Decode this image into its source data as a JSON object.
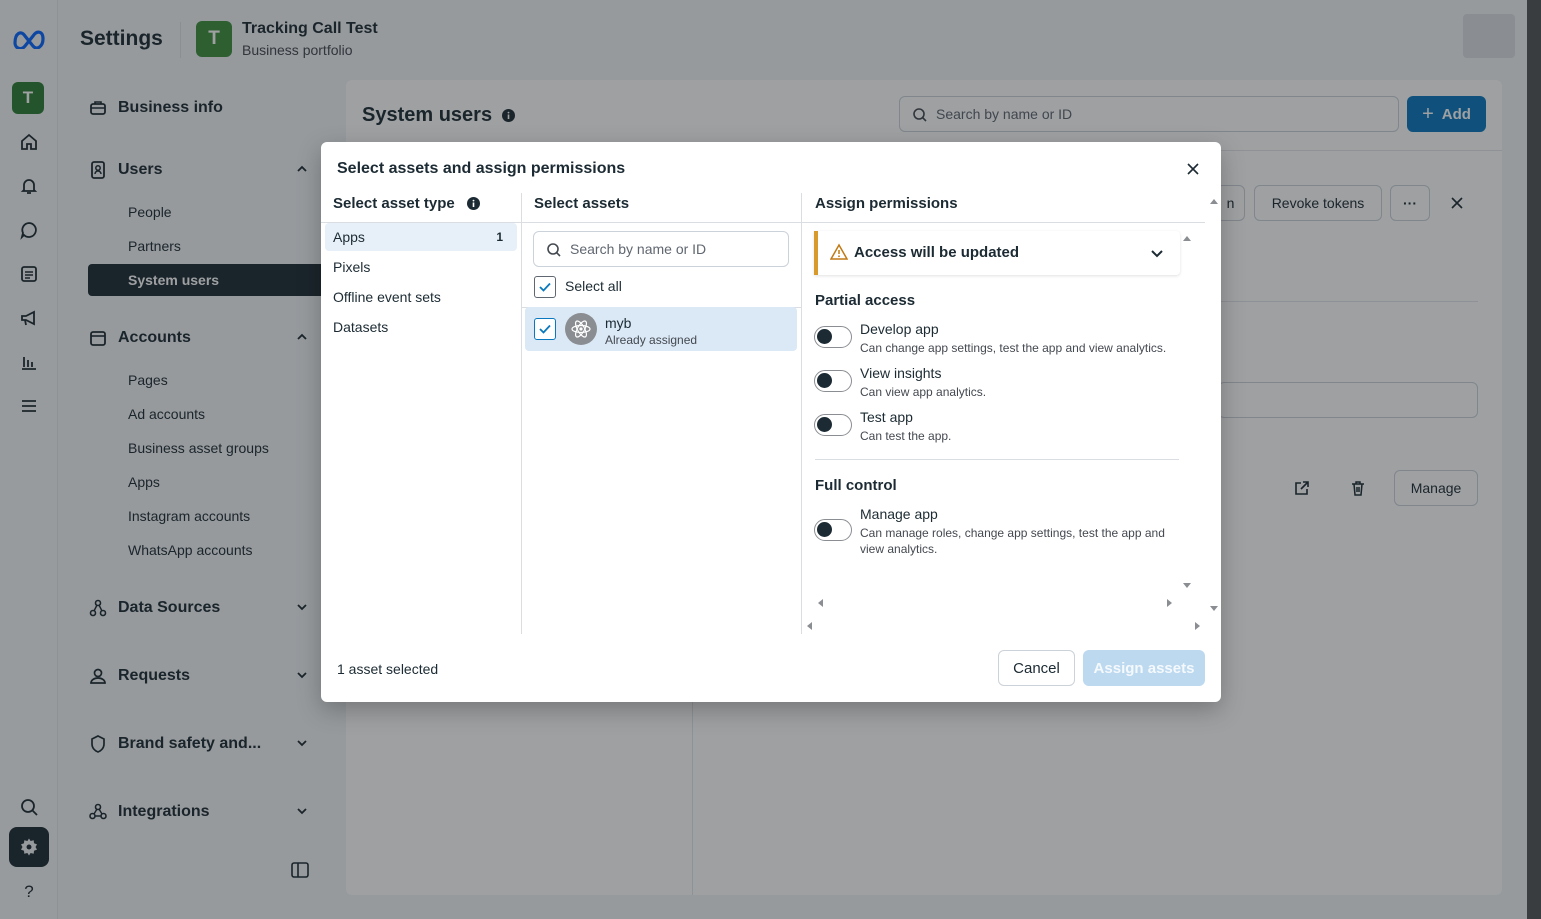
{
  "header": {
    "title": "Settings",
    "portfolio_initial": "T",
    "portfolio_name": "Tracking Call Test",
    "portfolio_sub": "Business portfolio"
  },
  "rail": {
    "avatar_initial": "T",
    "help": "?"
  },
  "sidebar": {
    "business_info": "Business info",
    "users": "Users",
    "users_items": [
      "People",
      "Partners",
      "System users"
    ],
    "accounts": "Accounts",
    "accounts_items": [
      "Pages",
      "Ad accounts",
      "Business asset groups",
      "Apps",
      "Instagram accounts",
      "WhatsApp accounts"
    ],
    "data_sources": "Data Sources",
    "requests": "Requests",
    "brand_safety": "Brand safety and...",
    "integrations": "Integrations"
  },
  "main": {
    "title": "System users",
    "search_placeholder": "Search by name or ID",
    "add_label": "Add",
    "partial_btn": "n",
    "revoke_label": "Revoke tokens",
    "more_label": "···",
    "manage_label": "Manage"
  },
  "modal": {
    "title": "Select assets and assign permissions",
    "col_asset_type": "Select asset type",
    "col_assets": "Select assets",
    "col_permissions": "Assign permissions",
    "asset_types": [
      {
        "label": "Apps",
        "count": "1"
      },
      {
        "label": "Pixels",
        "count": ""
      },
      {
        "label": "Offline event sets",
        "count": ""
      },
      {
        "label": "Datasets",
        "count": ""
      }
    ],
    "assets_search_placeholder": "Search by name or ID",
    "select_all_label": "Select all",
    "asset": {
      "name": "myb",
      "sub": "Already assigned"
    },
    "warning": "Access will be updated",
    "partial_access": "Partial access",
    "full_control": "Full control",
    "permissions": [
      {
        "name": "Develop app",
        "desc": "Can change app settings, test the app and view analytics."
      },
      {
        "name": "View insights",
        "desc": "Can view app analytics."
      },
      {
        "name": "Test app",
        "desc": "Can test the app."
      },
      {
        "name": "Manage app",
        "desc": "Can manage roles, change app settings, test the app and view analytics."
      }
    ],
    "footer_status": "1 asset selected",
    "cancel_label": "Cancel",
    "assign_label": "Assign assets"
  },
  "colors": {
    "accent": "#0a78be",
    "dark": "#1c2b33",
    "warning": "#d89b2b",
    "selected_bg": "#dbe9f6"
  }
}
